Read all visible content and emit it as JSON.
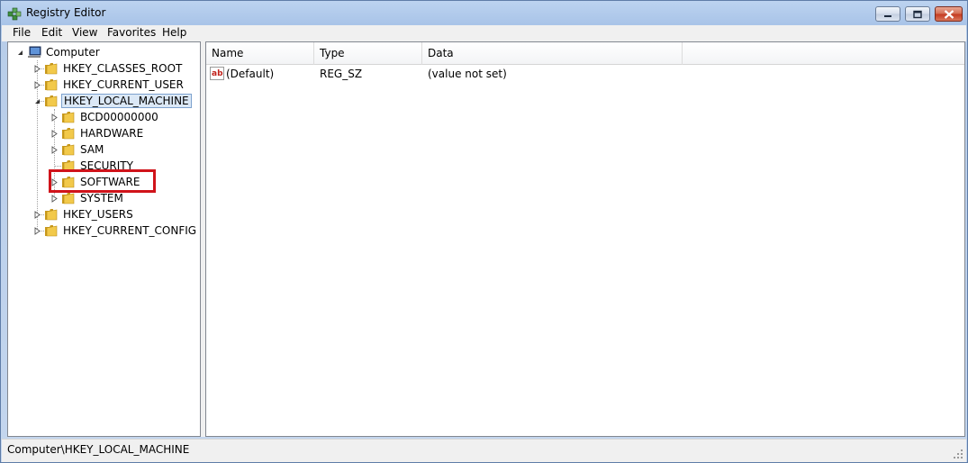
{
  "window": {
    "title": "Registry Editor"
  },
  "menu": [
    "File",
    "Edit",
    "View",
    "Favorites",
    "Help"
  ],
  "tree": {
    "root": "Computer",
    "hives": [
      {
        "label": "HKEY_CLASSES_ROOT",
        "expanded": false
      },
      {
        "label": "HKEY_CURRENT_USER",
        "expanded": false
      },
      {
        "label": "HKEY_LOCAL_MACHINE",
        "expanded": true,
        "selected": true,
        "children": [
          {
            "label": "BCD00000000",
            "has_children": true
          },
          {
            "label": "HARDWARE",
            "has_children": true
          },
          {
            "label": "SAM",
            "has_children": true
          },
          {
            "label": "SECURITY",
            "has_children": false
          },
          {
            "label": "SOFTWARE",
            "has_children": true,
            "highlighted": true
          },
          {
            "label": "SYSTEM",
            "has_children": true
          }
        ]
      },
      {
        "label": "HKEY_USERS",
        "expanded": false
      },
      {
        "label": "HKEY_CURRENT_CONFIG",
        "expanded": false
      }
    ]
  },
  "list": {
    "columns": [
      "Name",
      "Type",
      "Data"
    ],
    "rows": [
      {
        "name": "(Default)",
        "type": "REG_SZ",
        "data": "(value not set)",
        "icon": "string-value-icon"
      }
    ]
  },
  "status": {
    "path": "Computer\\HKEY_LOCAL_MACHINE"
  },
  "colors": {
    "highlight_box": "#d0131a",
    "selection": "#dbe8f6",
    "folder": "#e8b830"
  }
}
